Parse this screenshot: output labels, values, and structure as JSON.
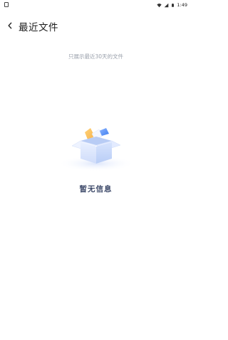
{
  "status_bar": {
    "time": "1:49"
  },
  "header": {
    "title": "最近文件",
    "back_icon": "chevron-left-icon"
  },
  "notice": "只展示最近30天的文件",
  "empty_state": {
    "message": "暂无信息",
    "illustration": "open-box-illustration"
  }
}
